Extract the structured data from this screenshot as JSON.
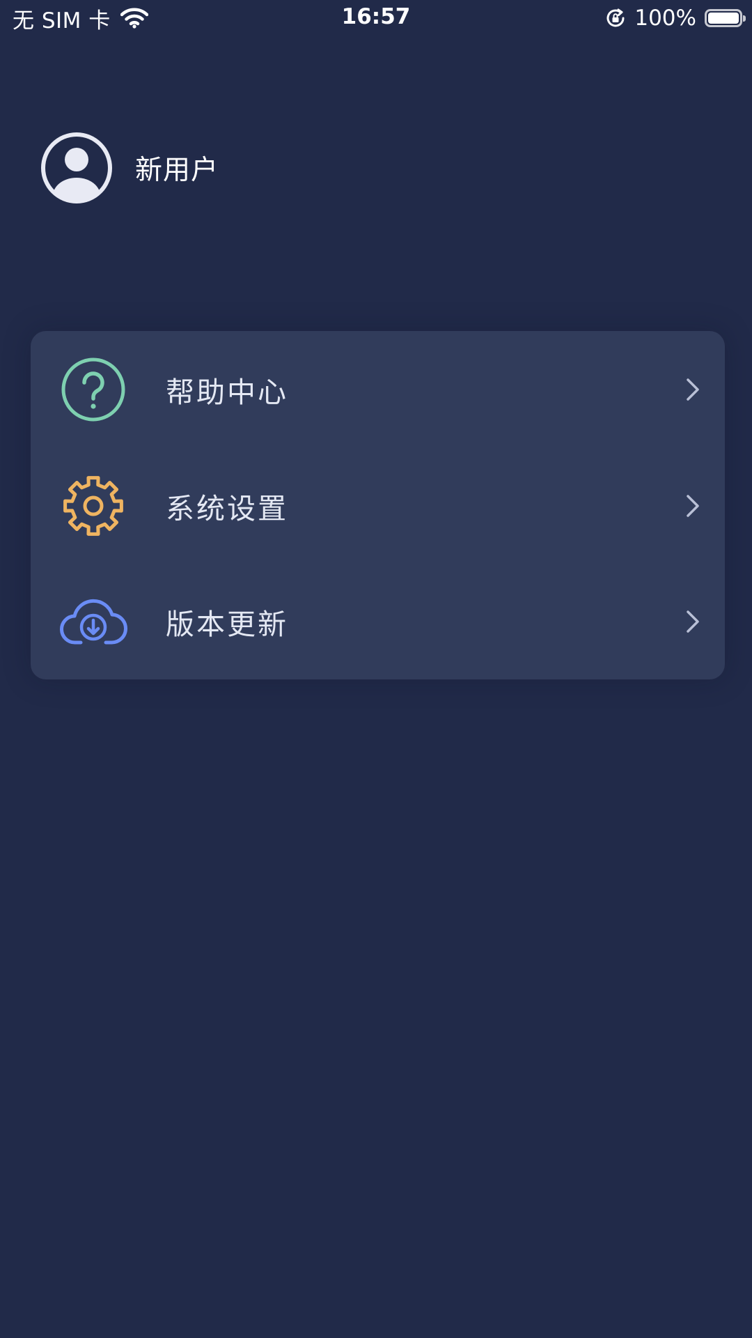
{
  "status_bar": {
    "carrier": "无 SIM 卡",
    "time": "16:57",
    "battery_percent_text": "100%",
    "battery_level": 1.0,
    "icons": [
      "wifi-icon",
      "rotation-lock-icon",
      "battery-icon"
    ]
  },
  "profile": {
    "username": "新用户",
    "icon": "user-avatar-icon"
  },
  "menu": {
    "items": [
      {
        "label": "帮助中心",
        "icon": "help-question-icon",
        "color": "#7ed0b0"
      },
      {
        "label": "系统设置",
        "icon": "gear-icon",
        "color": "#efb461"
      },
      {
        "label": "版本更新",
        "icon": "cloud-download-icon",
        "color": "#6a8cf5"
      }
    ]
  },
  "colors": {
    "background": "#212a49",
    "card": "#313c5b",
    "text": "#e4e8f3",
    "chevron": "#b9c0d6"
  }
}
